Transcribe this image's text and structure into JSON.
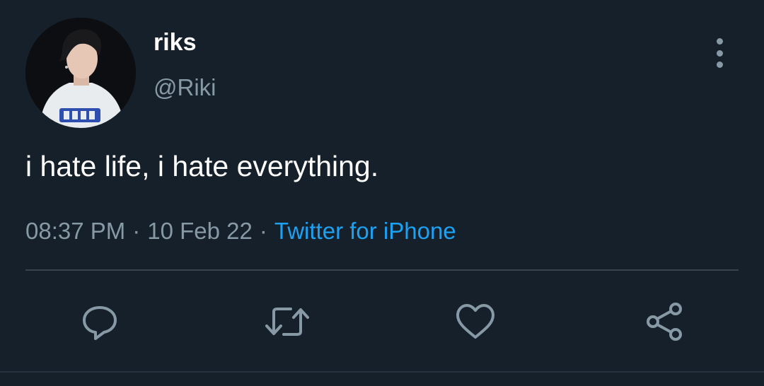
{
  "tweet": {
    "author": {
      "display_name": "riks",
      "handle": "@Riki"
    },
    "text": "i hate life, i hate everything.",
    "time": "08:37 PM",
    "separator": "·",
    "date": "10 Feb 22",
    "source": "Twitter for iPhone"
  },
  "actions": {
    "reply_icon": "reply-icon",
    "retweet_icon": "retweet-icon",
    "like_icon": "heart-icon",
    "share_icon": "share-icon"
  },
  "colors": {
    "background": "#15202b",
    "primary_text": "#ffffff",
    "secondary_text": "#8899a6",
    "link": "#1da1f2",
    "divider": "#38444d"
  }
}
